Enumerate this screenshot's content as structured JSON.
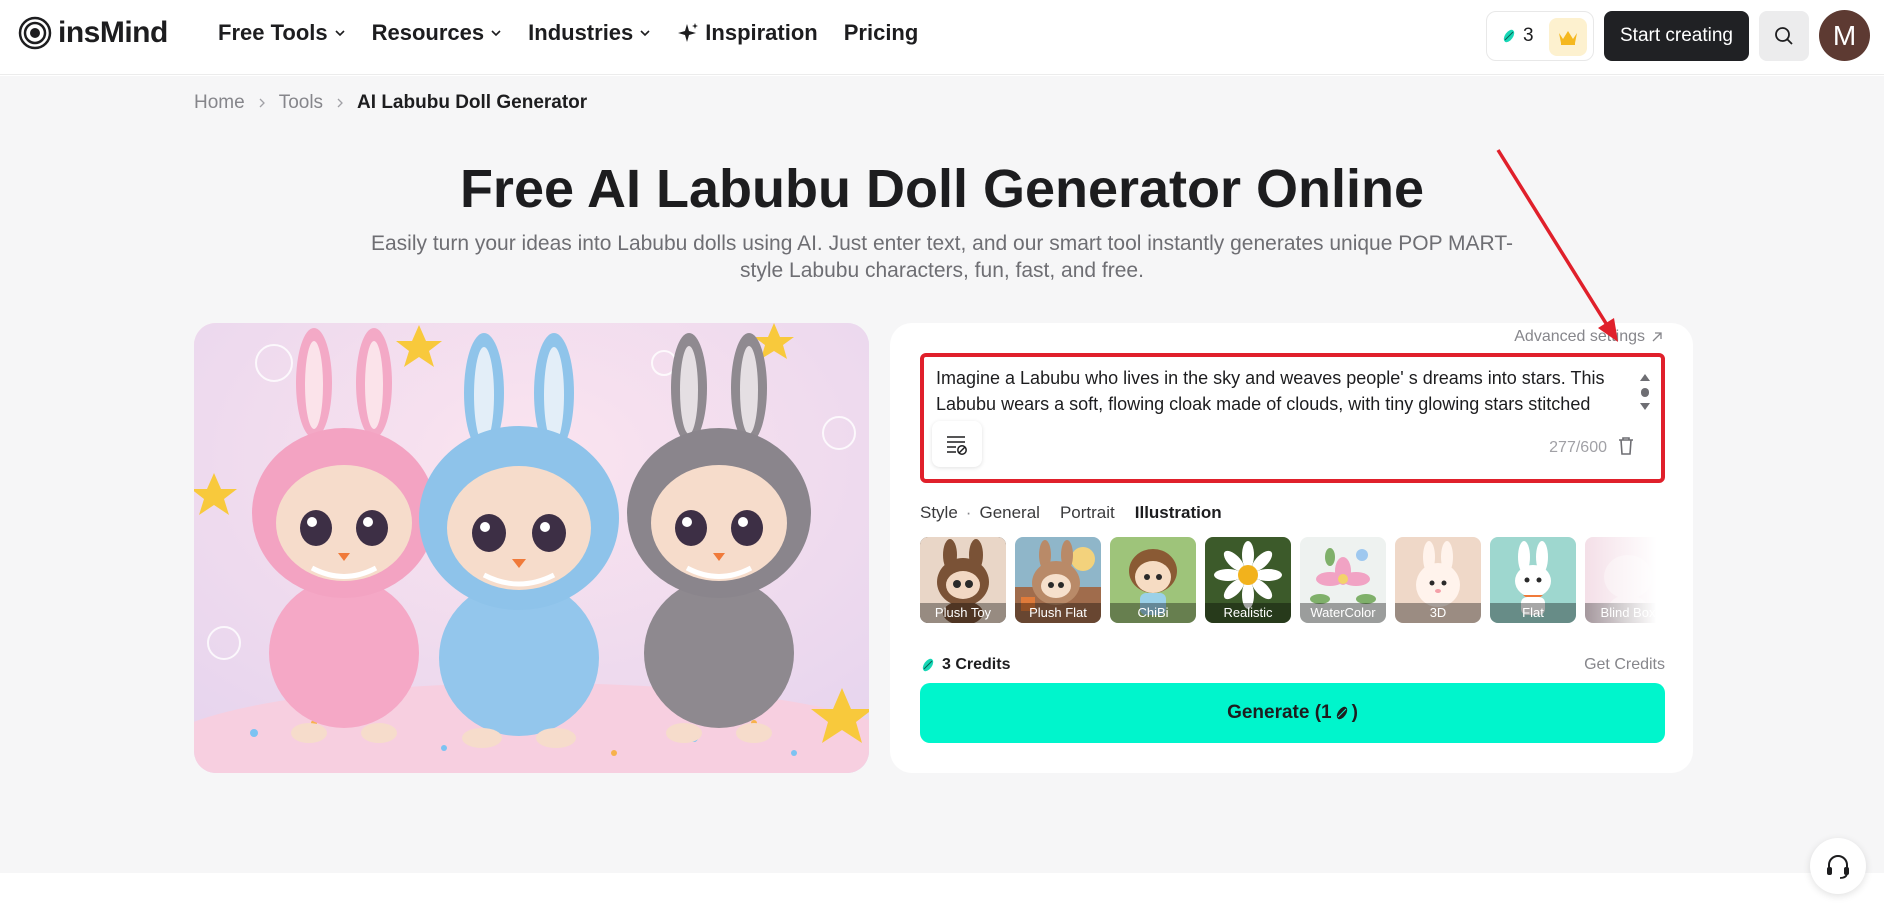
{
  "header": {
    "logo_text": "insMind",
    "nav": [
      {
        "label": "Free Tools",
        "dropdown": true
      },
      {
        "label": "Resources",
        "dropdown": true
      },
      {
        "label": "Industries",
        "dropdown": true
      },
      {
        "label": "Inspiration",
        "dropdown": false
      },
      {
        "label": "Pricing",
        "dropdown": false
      }
    ],
    "credits_count": "3",
    "start_label": "Start creating",
    "avatar_initial": "M"
  },
  "breadcrumb": [
    "Home",
    "Tools",
    "AI Labubu Doll Generator"
  ],
  "hero": {
    "title": "Free AI Labubu Doll Generator Online",
    "subtitle": "Easily turn your ideas into Labubu dolls using AI. Just enter text, and our smart tool instantly generates unique POP MART-style Labubu characters, fun, fast, and free."
  },
  "panel": {
    "advanced_label": "Advanced settings",
    "prompt_value": "Imagine a Labubu who lives in the sky and weaves people' s dreams into stars. This Labubu wears a soft, flowing cloak made of clouds, with tiny glowing stars stitched",
    "char_count": "277/600",
    "style_label": "Style",
    "style_tabs": [
      "General",
      "Portrait",
      "Illustration"
    ],
    "active_tab": "Illustration",
    "styles": [
      "Plush Toy",
      "Plush Flat",
      "ChiBi",
      "Realistic",
      "WaterColor",
      "3D",
      "Flat",
      "Blind Box"
    ],
    "selected_style": "Plush Toy",
    "credits_label": "3 Credits",
    "get_credits_label": "Get Credits",
    "generate_label": "Generate (1",
    "generate_suffix": ")"
  },
  "colors": {
    "accent": "#00f5cc",
    "highlight_box": "#e0202b",
    "dark_button": "#202124",
    "avatar_bg": "#5d3a32"
  }
}
